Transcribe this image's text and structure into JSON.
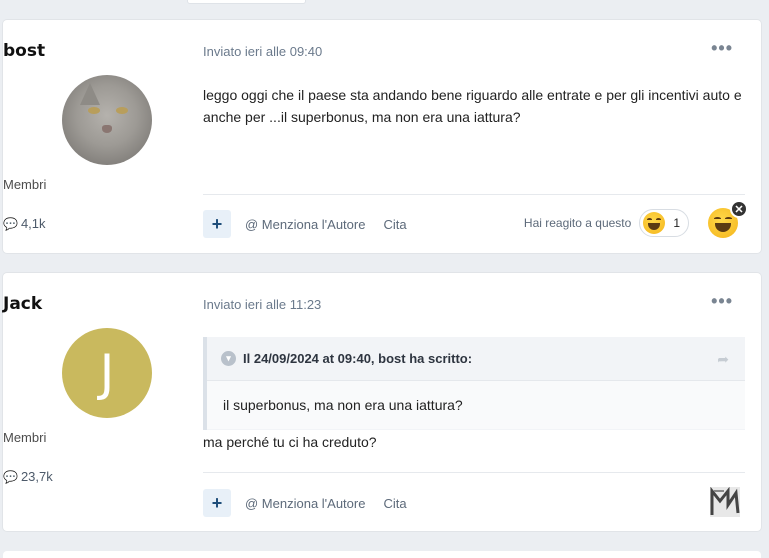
{
  "posts": [
    {
      "author": "bost",
      "role": "Membri",
      "post_count": "4,1k",
      "posted": "Inviato ieri alle 09:40",
      "more": "•••",
      "content": "leggo oggi che  il paese sta andando bene riguardo alle entrate e per gli incentivi auto e anche per ...il superbonus, ma non era una iattura?",
      "mention_label": "@ Menziona l'Autore",
      "quote_label": "Cita",
      "reacted_label": "Hai reagito a questo",
      "reaction_count": "1",
      "reaction_icon": "laughing-emoji-icon"
    },
    {
      "author": "Jack",
      "avatar_letter": "J",
      "avatar_color": "#c9b95e",
      "role": "Membri",
      "post_count": "23,7k",
      "posted": "Inviato ieri alle 11:23",
      "more": "•••",
      "quote_header": "Il 24/09/2024 at 09:40, bost ha scritto:",
      "quote_text": "il superbonus, ma non era una iattura?",
      "content": "ma perché tu ci ha creduto?",
      "mention_label": "@ Menziona l'Autore",
      "quote_label": "Cita"
    }
  ],
  "colors": {
    "accent": "#1f4e7a",
    "page_bg": "#ebeef2"
  }
}
